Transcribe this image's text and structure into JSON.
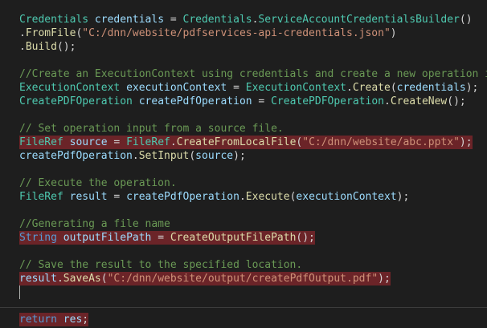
{
  "editor": {
    "colors": {
      "background": "#1e1e1e",
      "type": "#4ec9b0",
      "variable": "#9cdcfe",
      "method": "#dcdcaa",
      "string": "#ce9178",
      "comment": "#6a9955",
      "keyword": "#569cd6",
      "plain": "#d4d4d4",
      "highlight": "#6b2428"
    },
    "lines": [
      {
        "tokens": [
          {
            "k": "type",
            "t": "Credentials"
          },
          {
            "k": "plain",
            "t": " "
          },
          {
            "k": "var",
            "t": "credentials"
          },
          {
            "k": "plain",
            "t": " = "
          },
          {
            "k": "type",
            "t": "Credentials"
          },
          {
            "k": "plain",
            "t": "."
          },
          {
            "k": "type",
            "t": "ServiceAccountCredentialsBuilder"
          },
          {
            "k": "plain",
            "t": "()"
          }
        ]
      },
      {
        "tokens": [
          {
            "k": "plain",
            "t": "."
          },
          {
            "k": "meth",
            "t": "FromFile"
          },
          {
            "k": "plain",
            "t": "("
          },
          {
            "k": "str",
            "t": "\"C:/dnn/website/pdfservices-api-credentials.json\""
          },
          {
            "k": "plain",
            "t": ")"
          }
        ]
      },
      {
        "tokens": [
          {
            "k": "plain",
            "t": "."
          },
          {
            "k": "meth",
            "t": "Build"
          },
          {
            "k": "plain",
            "t": "();"
          }
        ]
      },
      {
        "tokens": []
      },
      {
        "tokens": [
          {
            "k": "com",
            "t": "//Create an ExecutionContext using credentials and create a new operation ins"
          }
        ]
      },
      {
        "tokens": [
          {
            "k": "type",
            "t": "ExecutionContext"
          },
          {
            "k": "plain",
            "t": " "
          },
          {
            "k": "var",
            "t": "executionContext"
          },
          {
            "k": "plain",
            "t": " = "
          },
          {
            "k": "type",
            "t": "ExecutionContext"
          },
          {
            "k": "plain",
            "t": "."
          },
          {
            "k": "meth",
            "t": "Create"
          },
          {
            "k": "plain",
            "t": "("
          },
          {
            "k": "var",
            "t": "credentials"
          },
          {
            "k": "plain",
            "t": ");"
          }
        ]
      },
      {
        "tokens": [
          {
            "k": "type",
            "t": "CreatePDFOperation"
          },
          {
            "k": "plain",
            "t": " "
          },
          {
            "k": "var",
            "t": "createPdfOperation"
          },
          {
            "k": "plain",
            "t": " = "
          },
          {
            "k": "type",
            "t": "CreatePDFOperation"
          },
          {
            "k": "plain",
            "t": "."
          },
          {
            "k": "meth",
            "t": "CreateNew"
          },
          {
            "k": "plain",
            "t": "();"
          }
        ]
      },
      {
        "tokens": []
      },
      {
        "tokens": [
          {
            "k": "com",
            "t": "// Set operation input from a source file."
          }
        ]
      },
      {
        "highlight": true,
        "tokens": [
          {
            "k": "type",
            "t": "FileRef"
          },
          {
            "k": "plain",
            "t": " "
          },
          {
            "k": "var",
            "t": "source"
          },
          {
            "k": "plain",
            "t": " = "
          },
          {
            "k": "type",
            "t": "FileRef"
          },
          {
            "k": "plain",
            "t": "."
          },
          {
            "k": "meth",
            "t": "CreateFromLocalFile"
          },
          {
            "k": "plain",
            "t": "("
          },
          {
            "k": "str",
            "t": "\"C:/dnn/website/abc.pptx\""
          },
          {
            "k": "plain",
            "t": ");"
          }
        ]
      },
      {
        "tokens": [
          {
            "k": "var",
            "t": "createPdfOperation"
          },
          {
            "k": "plain",
            "t": "."
          },
          {
            "k": "meth",
            "t": "SetInput"
          },
          {
            "k": "plain",
            "t": "("
          },
          {
            "k": "var",
            "t": "source"
          },
          {
            "k": "plain",
            "t": ");"
          }
        ]
      },
      {
        "tokens": []
      },
      {
        "tokens": [
          {
            "k": "com",
            "t": "// Execute the operation."
          }
        ]
      },
      {
        "tokens": [
          {
            "k": "type",
            "t": "FileRef"
          },
          {
            "k": "plain",
            "t": " "
          },
          {
            "k": "var",
            "t": "result"
          },
          {
            "k": "plain",
            "t": " = "
          },
          {
            "k": "var",
            "t": "createPdfOperation"
          },
          {
            "k": "plain",
            "t": "."
          },
          {
            "k": "meth",
            "t": "Execute"
          },
          {
            "k": "plain",
            "t": "("
          },
          {
            "k": "var",
            "t": "executionContext"
          },
          {
            "k": "plain",
            "t": ");"
          }
        ]
      },
      {
        "tokens": []
      },
      {
        "tokens": [
          {
            "k": "com",
            "t": "//Generating a file name"
          }
        ]
      },
      {
        "highlight": true,
        "tokens": [
          {
            "k": "key",
            "t": "String"
          },
          {
            "k": "plain",
            "t": " "
          },
          {
            "k": "var",
            "t": "outputFilePath"
          },
          {
            "k": "plain",
            "t": " = "
          },
          {
            "k": "meth",
            "t": "CreateOutputFilePath"
          },
          {
            "k": "plain",
            "t": "();"
          }
        ]
      },
      {
        "tokens": []
      },
      {
        "tokens": [
          {
            "k": "com",
            "t": "// Save the result to the specified location."
          }
        ]
      },
      {
        "highlight": true,
        "tokens": [
          {
            "k": "var",
            "t": "result"
          },
          {
            "k": "plain",
            "t": "."
          },
          {
            "k": "meth",
            "t": "SaveAs"
          },
          {
            "k": "plain",
            "t": "("
          },
          {
            "k": "str",
            "t": "\"C:/dnn/website/output/createPdfOutput.pdf\""
          },
          {
            "k": "plain",
            "t": ");"
          }
        ]
      },
      {
        "cursor": true,
        "tokens": []
      },
      {
        "tokens": []
      },
      {
        "highlight": true,
        "tokens": [
          {
            "k": "key",
            "t": "return"
          },
          {
            "k": "plain",
            "t": " "
          },
          {
            "k": "var",
            "t": "res"
          },
          {
            "k": "plain",
            "t": ";"
          }
        ]
      }
    ]
  }
}
